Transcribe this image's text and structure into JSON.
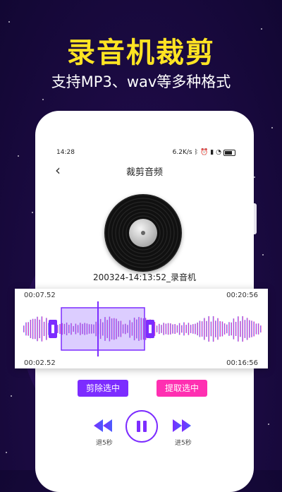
{
  "promo": {
    "headline": "录音机裁剪",
    "subline": "支持MP3、wav等多种格式"
  },
  "status_bar": {
    "time": "14:28",
    "speed": "6.2K/s"
  },
  "nav": {
    "back_icon": "chevron-left-icon",
    "title": "裁剪音频"
  },
  "record": {
    "filename": "200324-14:13:52_录音机"
  },
  "waveform": {
    "time_top_left": "00:07.52",
    "time_top_right": "00:20:56",
    "time_bottom_left": "00:02.52",
    "time_bottom_right": "00:16:56",
    "colors": {
      "start": "#35c3f5",
      "mid": "#8a4cff",
      "end": "#ff2fb1",
      "selection": "#7c2cff"
    }
  },
  "actions": {
    "delete_selection": "剪除选中",
    "extract_selection": "提取选中"
  },
  "playback": {
    "rewind_label": "退5秒",
    "forward_label": "进5秒",
    "rewind_icon": "rewind-icon",
    "pause_icon": "pause-icon",
    "forward_icon": "fast-forward-icon"
  }
}
